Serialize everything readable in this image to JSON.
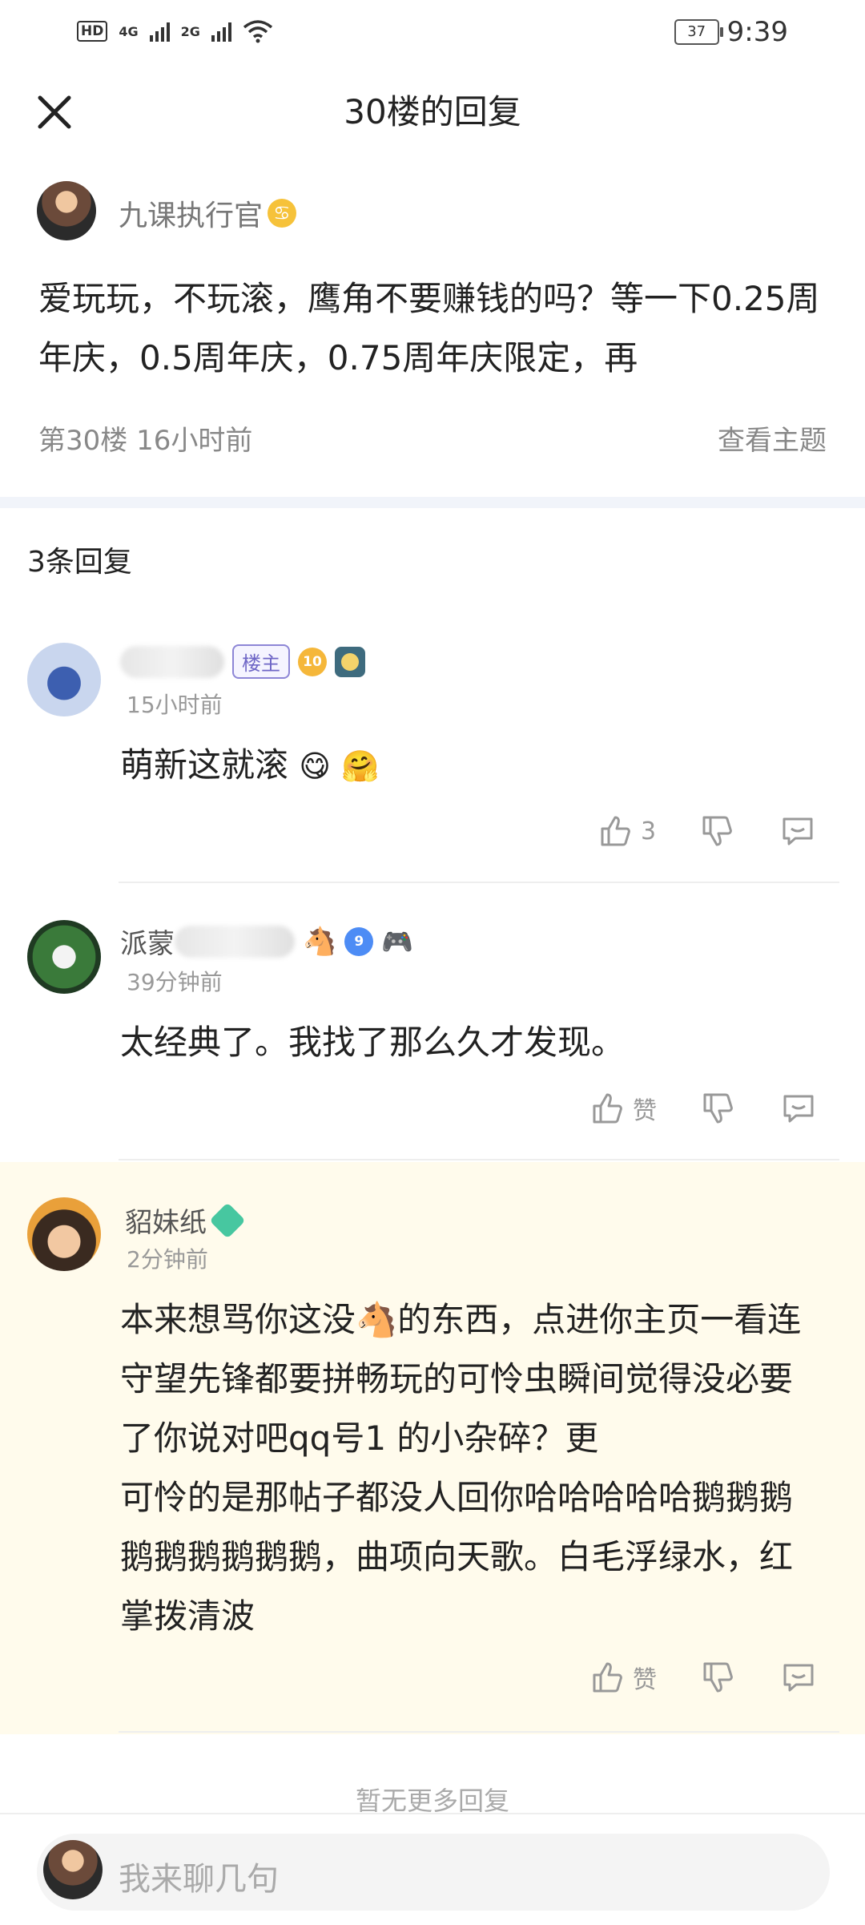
{
  "status_bar": {
    "hd": "HD",
    "sim1": "4G",
    "sim2": "2G",
    "battery": "37",
    "time": "9:39"
  },
  "header": {
    "title": "30楼的回复"
  },
  "post": {
    "author": "九课执行官",
    "content": "爱玩玩，不玩滚，鹰角不要赚钱的吗？等一下0.25周年庆，0.5周年庆，0.75周年庆限定，再",
    "floor_time": "第30楼  16小时前",
    "view_topic": "查看主题"
  },
  "replies_header": "3条回复",
  "replies": [
    {
      "owner_tag": "楼主",
      "level": "10",
      "time": "15小时前",
      "content": "萌新这就滚",
      "emojis": [
        "😋",
        "🤗"
      ],
      "like_label": "3"
    },
    {
      "name_visible": "派蒙",
      "level": "9",
      "time": "39分钟前",
      "content": "太经典了。我找了那么久才发现。",
      "like_label": "赞"
    },
    {
      "name": "貂妹纸",
      "time": "2分钟前",
      "content_lines": [
        "本来想骂你这没🐴的东西，点进你主页一看连",
        "守望先锋都要拼畅玩的可怜虫瞬间觉得没必要",
        "了你说对吧qq号1          的小杂碎？更",
        "可怜的是那帖子都没人回你哈哈哈哈哈鹅鹅鹅",
        "鹅鹅鹅鹅鹅鹅，曲项向天歌。白毛浮绿水，红",
        "掌拨清波"
      ],
      "like_label": "赞"
    }
  ],
  "no_more": "暂无更多回复",
  "input": {
    "placeholder": "我来聊几句"
  },
  "colors": {
    "highlight_bg": "#fffbec",
    "owner_tag": "#6e66c6",
    "divider": "#f1f4fa"
  }
}
